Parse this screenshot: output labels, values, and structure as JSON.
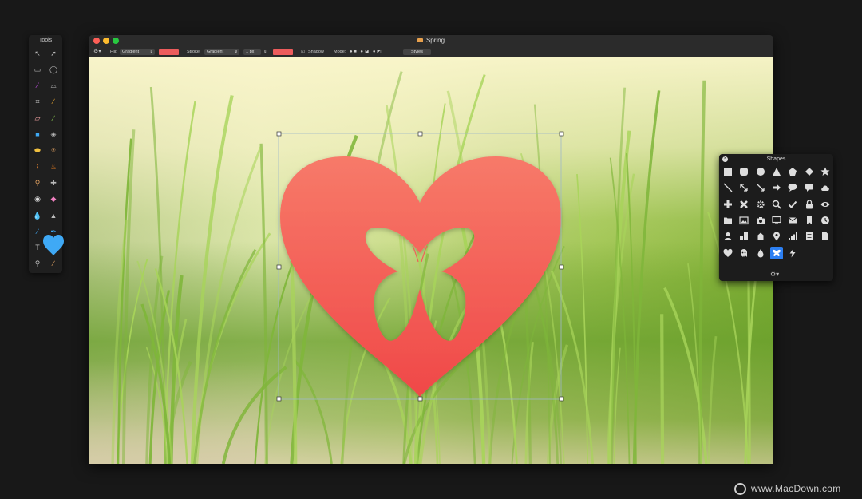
{
  "tools_panel": {
    "title": "Tools",
    "tools": [
      "arrow-select-icon",
      "direct-select-icon",
      "rect-select-icon",
      "ellipse-select-icon",
      "magic-wand-icon",
      "lasso-icon",
      "crop-icon",
      "eyedropper-icon",
      "eraser-icon",
      "pencil-icon",
      "shape-rect-icon",
      "paint-bucket-icon",
      "ellipse-fill-icon",
      "stamp-icon",
      "brush-icon",
      "burn-icon",
      "clone-icon",
      "repair-icon",
      "eye-icon",
      "smudge-icon",
      "droplet-icon",
      "sharpen-icon",
      "line-icon",
      "pen-icon",
      "text-icon",
      "heart-shape-icon",
      "zoom-icon",
      "color-picker-icon"
    ],
    "active_tool": "heart-shape-icon",
    "active_color": "#3fa9f5"
  },
  "window": {
    "title": "Spring",
    "accent": "#ec5c5c"
  },
  "toolbar": {
    "fill_label": "Fill:",
    "fill_value": "Gradient",
    "stroke_label": "Stroke:",
    "stroke_value": "Gradient",
    "stroke_width": "1 px",
    "shadow_label": "Shadow",
    "shadow_checked": true,
    "mode_label": "Mode:",
    "styles_label": "Styles",
    "fill_color": "#ec5c5c",
    "stroke_color": "#ec5c5c"
  },
  "canvas": {
    "shape": "heart-with-butterfly-cutout",
    "shape_color_top": "#f77a69",
    "shape_color_bottom": "#f04848"
  },
  "shapes_panel": {
    "title": "Shapes",
    "rows": [
      [
        "square-icon",
        "rounded-square-icon",
        "circle-icon",
        "triangle-icon",
        "pentagon-icon",
        "diamond-icon",
        "star-icon"
      ],
      [
        "line-icon",
        "double-arrow-icon",
        "arrow-line-icon",
        "arrow-right-icon",
        "speech-bubble-icon",
        "chat-bubble-icon",
        "cloud-icon"
      ],
      [
        "plus-icon",
        "x-icon",
        "gear-icon",
        "search-icon",
        "checkmark-icon",
        "lock-icon",
        "eye-icon"
      ],
      [
        "folder-icon",
        "image-icon",
        "camera-icon",
        "monitor-icon",
        "mail-icon",
        "bookmark-icon",
        "clock-icon"
      ],
      [
        "person-icon",
        "buildings-icon",
        "home-icon",
        "pin-icon",
        "signal-icon",
        "document-icon",
        "page-icon"
      ],
      [
        "heart-icon",
        "ghost-icon",
        "droplet-icon",
        "butterfly-icon",
        "lightning-icon"
      ]
    ],
    "selected": "butterfly-icon"
  },
  "watermark": {
    "text": "www.MacDown.com"
  }
}
